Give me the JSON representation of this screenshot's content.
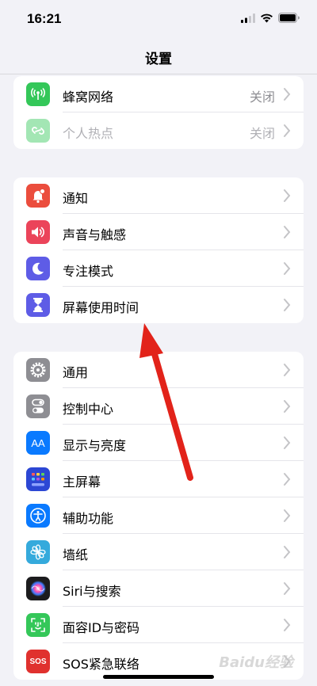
{
  "status_bar": {
    "time": "16:21"
  },
  "nav": {
    "title": "设置"
  },
  "group1": [
    {
      "label": "蜂窝网络",
      "value": "关闭",
      "icon": "cellular-icon",
      "color": "#34C759",
      "dim": false
    },
    {
      "label": "个人热点",
      "value": "关闭",
      "icon": "hotspot-icon",
      "color": "#34C759",
      "dim": true
    }
  ],
  "group2": [
    {
      "label": "通知",
      "icon": "bell-icon",
      "color": "#EB4D3D"
    },
    {
      "label": "声音与触感",
      "icon": "speaker-icon",
      "color": "#EB445A"
    },
    {
      "label": "专注模式",
      "icon": "moon-icon",
      "color": "#5E5CE6"
    },
    {
      "label": "屏幕使用时间",
      "icon": "hourglass-icon",
      "color": "#5E5CE6"
    }
  ],
  "group3": [
    {
      "label": "通用",
      "icon": "gear-icon",
      "color": "#8E8E93"
    },
    {
      "label": "控制中心",
      "icon": "toggles-icon",
      "color": "#8E8E93"
    },
    {
      "label": "显示与亮度",
      "icon": "text-size-icon",
      "color": "#0A7AFF"
    },
    {
      "label": "主屏幕",
      "icon": "home-grid-icon",
      "color": "#2C47D4"
    },
    {
      "label": "辅助功能",
      "icon": "accessibility-icon",
      "color": "#0A7AFF"
    },
    {
      "label": "墙纸",
      "icon": "flower-icon",
      "color": "#35AADC"
    },
    {
      "label": "Siri与搜索",
      "icon": "siri-icon",
      "color": "#1C1C1E"
    },
    {
      "label": "面容ID与密码",
      "icon": "faceid-icon",
      "color": "#34C759"
    },
    {
      "label": "SOS紧急联络",
      "icon": "sos-icon",
      "color": "#E0312E"
    }
  ],
  "labels": {
    "sos_badge": "SOS",
    "aa_badge": "AA"
  },
  "watermark": "Baidu经验"
}
